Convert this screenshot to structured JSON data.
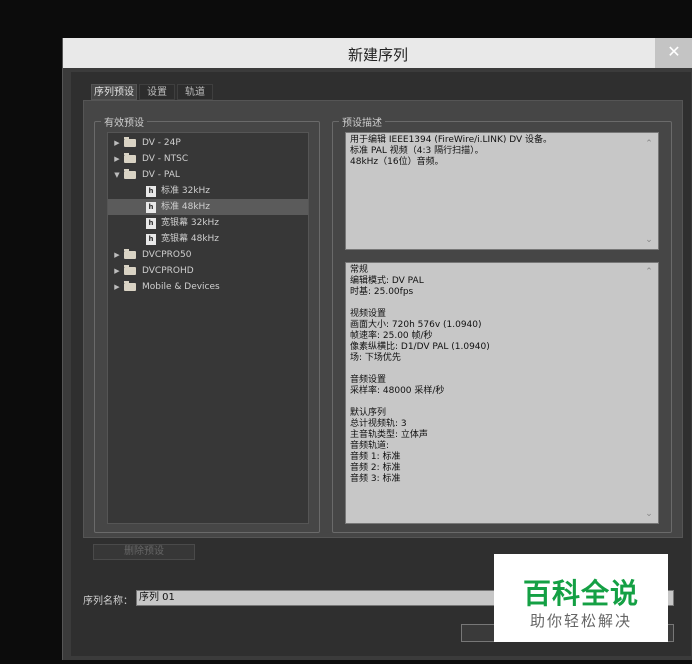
{
  "dialog": {
    "title": "新建序列",
    "close_glyph": "✕"
  },
  "tabs": [
    {
      "label": "序列预设"
    },
    {
      "label": "设置"
    },
    {
      "label": "轨道"
    }
  ],
  "presets": {
    "group_label": "有效预设",
    "items": [
      {
        "label": "DV - 24P"
      },
      {
        "label": "DV - NTSC"
      },
      {
        "label": "DV - PAL"
      },
      {
        "label": "标准 32kHz"
      },
      {
        "label": "标准 48kHz"
      },
      {
        "label": "宽银幕 32kHz"
      },
      {
        "label": "宽银幕 48kHz"
      },
      {
        "label": "DVCPRO50"
      },
      {
        "label": "DVCPROHD"
      },
      {
        "label": "Mobile & Devices"
      }
    ],
    "collapsed_glyph": "▶",
    "expanded_glyph": "▼",
    "file_glyph": "h"
  },
  "description": {
    "group_label": "预设描述",
    "lines": [
      "用于编辑 IEEE1394 (FireWire/i.LINK) DV 设备。",
      "标准 PAL 视频（4:3 隔行扫描）。",
      "48kHz（16位）音频。"
    ]
  },
  "details": {
    "lines": [
      "常规",
      " 编辑模式: DV PAL",
      " 时基: 25.00fps",
      "",
      "视频设置",
      " 画面大小: 720h 576v (1.0940)",
      " 帧速率: 25.00 帧/秒",
      " 像素纵横比: D1/DV PAL (1.0940)",
      " 场: 下场优先",
      "",
      "音频设置",
      " 采样率: 48000 采样/秒",
      "",
      "默认序列",
      " 总计视频轨: 3",
      " 主音轨类型: 立体声",
      " 音频轨道:",
      " 音频 1: 标准",
      " 音频 2: 标准",
      " 音频 3: 标准"
    ]
  },
  "scroll": {
    "up": "⌃",
    "down": "⌄"
  },
  "delete_button": "删除预设",
  "sequence_name": {
    "label": "序列名称：",
    "value": "序列 01"
  },
  "watermark": {
    "main": "百科全说",
    "sub": "助你轻松解决"
  }
}
